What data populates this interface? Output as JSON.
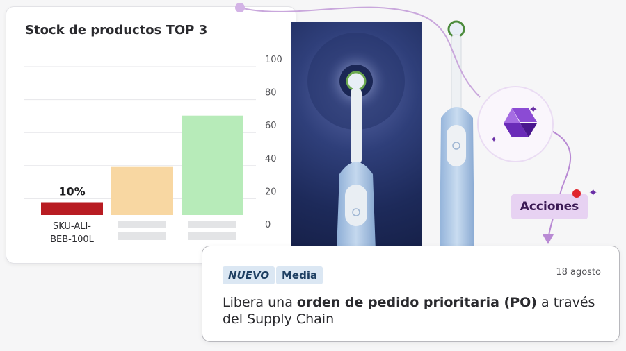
{
  "chart_card": {
    "title": "Stock de productos TOP 3"
  },
  "chart_data": {
    "type": "bar",
    "title": "Stock de productos TOP 3",
    "categories": [
      "SKU-ALI-BEB-100L",
      "",
      ""
    ],
    "category_lines": [
      [
        "SKU-ALI-",
        "BEB-100L"
      ],
      [],
      []
    ],
    "values": [
      8,
      30,
      62
    ],
    "data_labels": [
      "10%",
      "",
      ""
    ],
    "colors": [
      "#b81c22",
      "#f8d7a2",
      "#b7ebb9"
    ],
    "ylim": [
      0,
      100
    ],
    "yticks": [
      0,
      20,
      40,
      60,
      80,
      100
    ],
    "y_axis_side": "right",
    "grid": true,
    "xlabel": "",
    "ylabel": ""
  },
  "actions": {
    "label": "Acciones"
  },
  "notification": {
    "tag_new": "NUEVO",
    "tag_priority": "Media",
    "date": "18 agosto",
    "message_pre": "Libera una ",
    "message_bold": "orden de pedido prioritaria (PO)",
    "message_post": " a través del Supply Chain"
  },
  "icons": {
    "logo": "power-automate-logo-icon",
    "sparkle": "sparkle-icon",
    "toothbrush": "toothbrush-image"
  }
}
